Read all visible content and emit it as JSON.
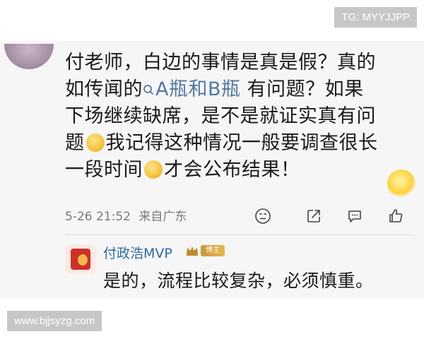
{
  "comment": {
    "line1": "付老师，白边的事情是真是假？真的",
    "line2_start": "如传闻的",
    "topic_icon": "search-icon",
    "topic": "A瓶和B瓶",
    "line2_end": " 有问题？如果",
    "line3": "下场继续缺席，是不是就证实真有问",
    "line4_start": "题",
    "line4_end": "我记得这种情况一般要调查很长",
    "line5_start": "一段时间",
    "line5_end": "才会公布结果！",
    "time": "5-26 21:52",
    "location": "来自广东"
  },
  "icons": {
    "emoji1": "laughing-emoji-icon",
    "emoji2": "thinking-emoji-icon",
    "decor": "sun-sticker-icon",
    "actions": [
      "dislike-face-icon",
      "share-icon",
      "comment-icon",
      "like-icon"
    ]
  },
  "reply": {
    "name": "付政浩MVP",
    "badge": "博主",
    "text": "是的，流程比较复杂，必须慎重。"
  },
  "watermarks": {
    "top": "TG: MYYJJPP",
    "bottom": "www.bjjsyzg.com"
  },
  "colors": {
    "topic_blue": "#4f78a6",
    "name_blue": "#2f6aa8",
    "meta_gray": "#7a7a7a"
  }
}
